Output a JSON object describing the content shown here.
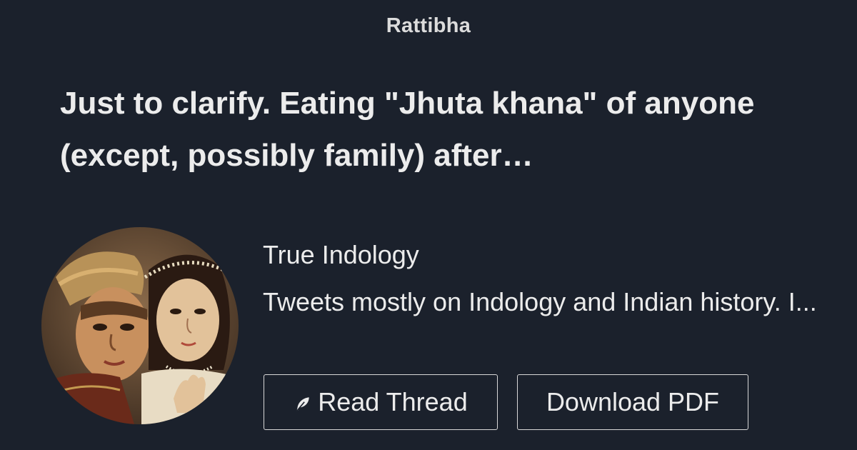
{
  "site": {
    "name": "Rattibha"
  },
  "thread": {
    "headline": "Just to clarify. Eating \"Jhuta khana\" of anyone (except, possibly family) after…"
  },
  "author": {
    "name": "True Indology",
    "bio": "Tweets mostly on Indology and Indian history. I...",
    "avatar_icon": "portrait-painting-avatar"
  },
  "actions": {
    "read_thread": {
      "label": "Read Thread",
      "icon": "feather-icon"
    },
    "download_pdf": {
      "label": "Download PDF"
    }
  },
  "colors": {
    "background": "#1b212c",
    "text": "#ececec",
    "button_border": "#d8d8d8"
  }
}
